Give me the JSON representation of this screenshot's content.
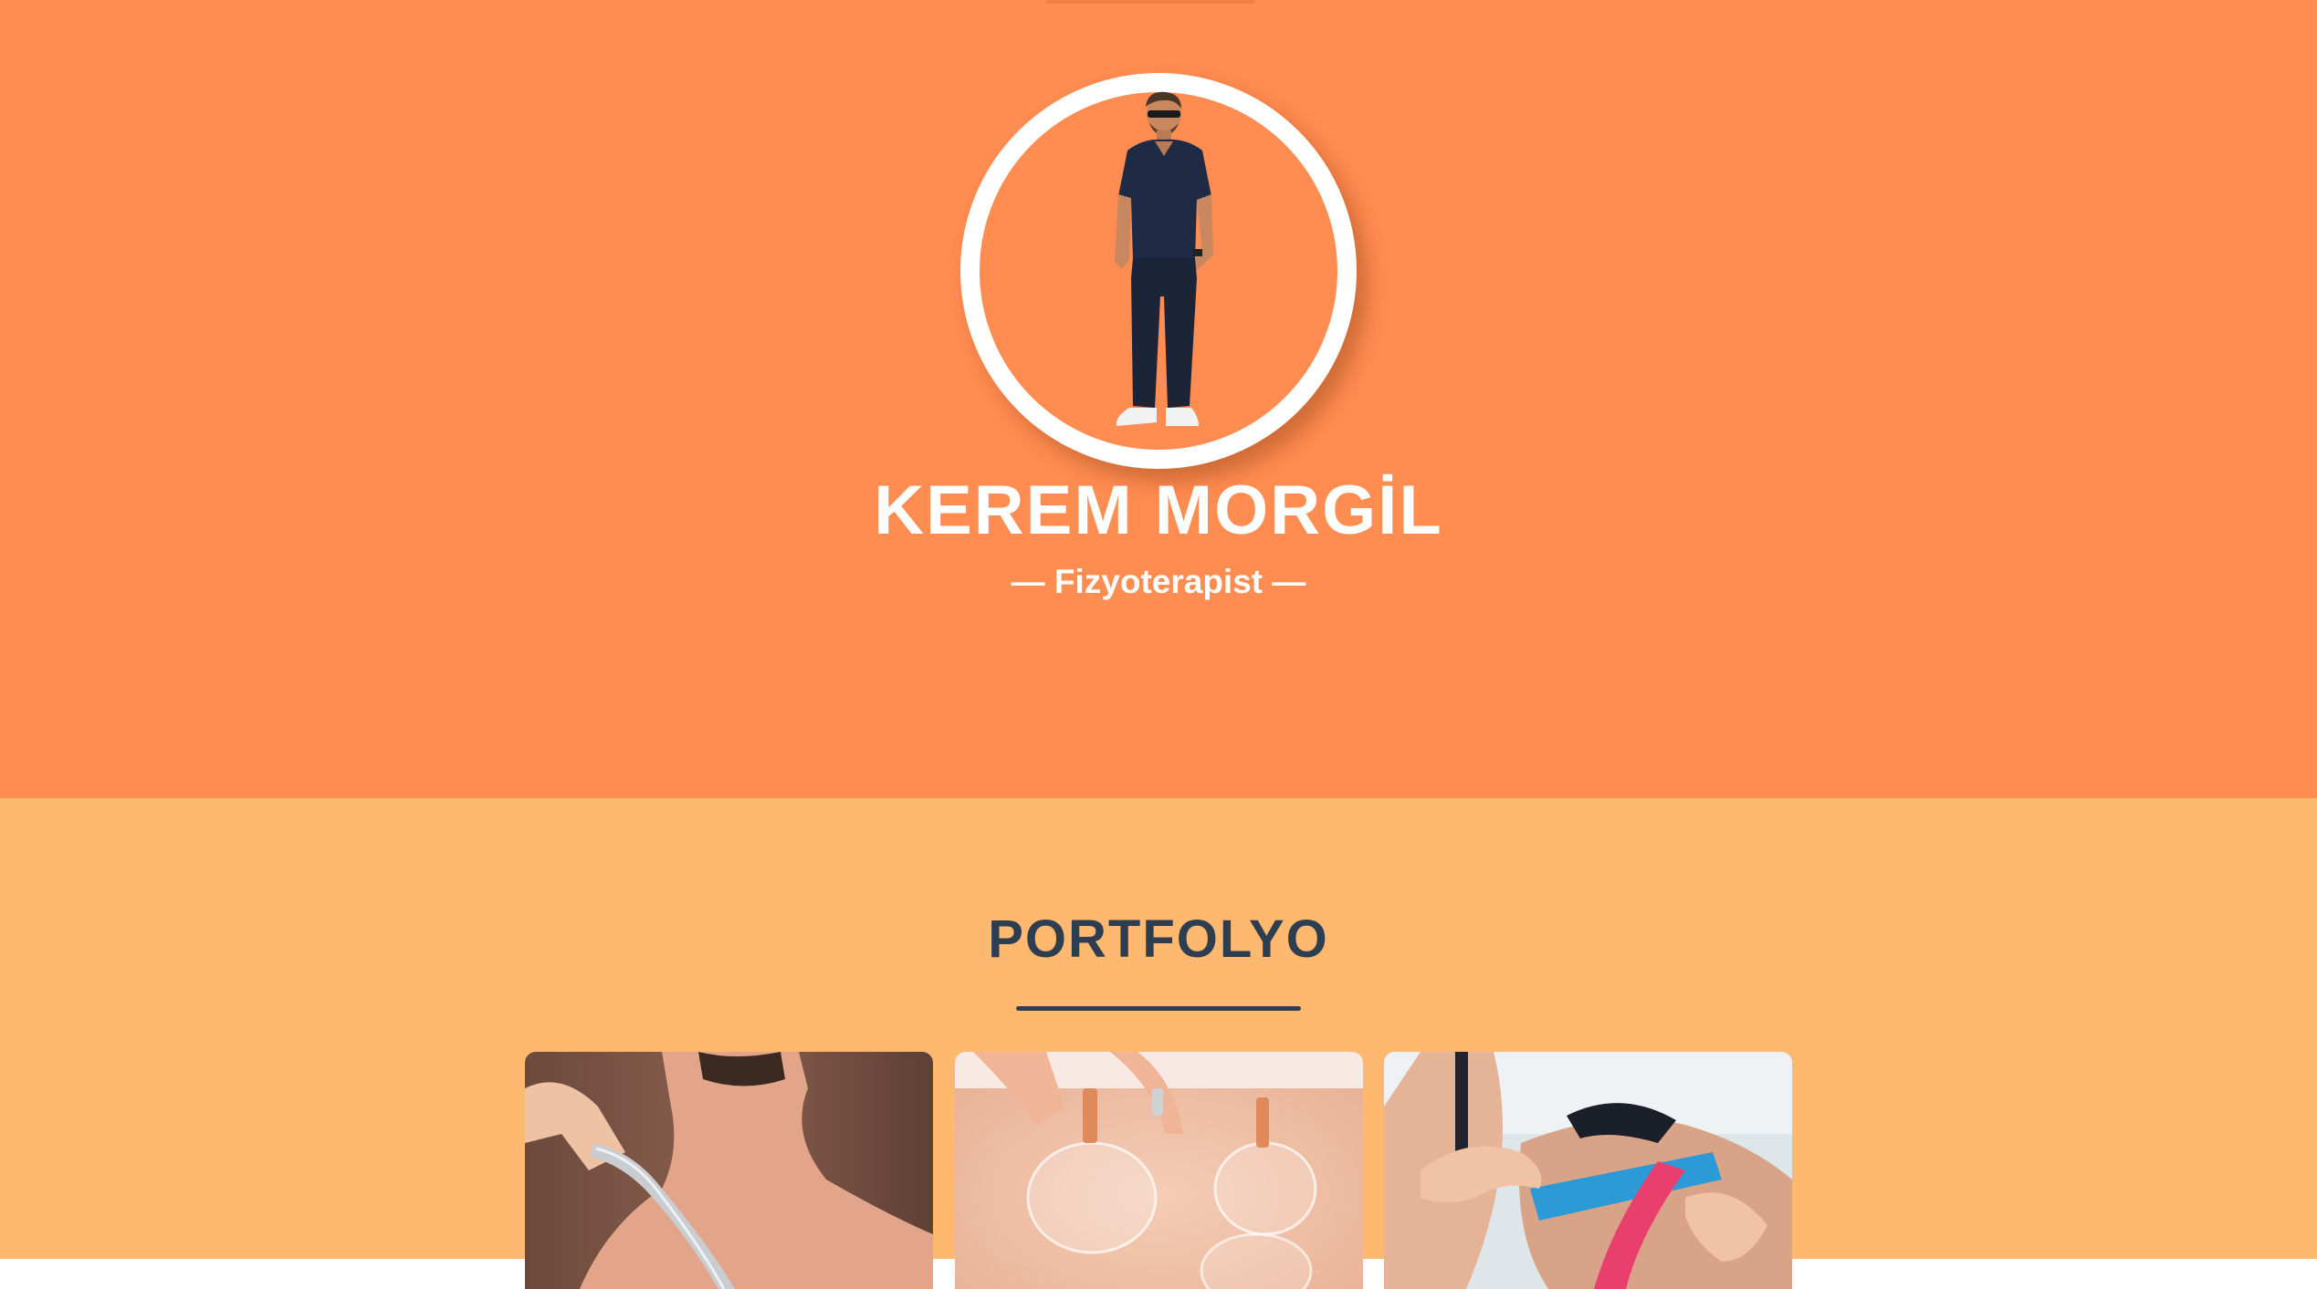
{
  "hero": {
    "name": "KEREM MORGİL",
    "subtitle": "— Fizyoterapist —",
    "background": "#ff8c51"
  },
  "portfolio": {
    "title": "PORTFOLYO",
    "background": "#ffb870",
    "title_color": "#2c3e50",
    "items": [
      {
        "name": "portfolio-item-massage-tool"
      },
      {
        "name": "portfolio-item-cupping"
      },
      {
        "name": "portfolio-item-kinesio-tape"
      }
    ]
  }
}
